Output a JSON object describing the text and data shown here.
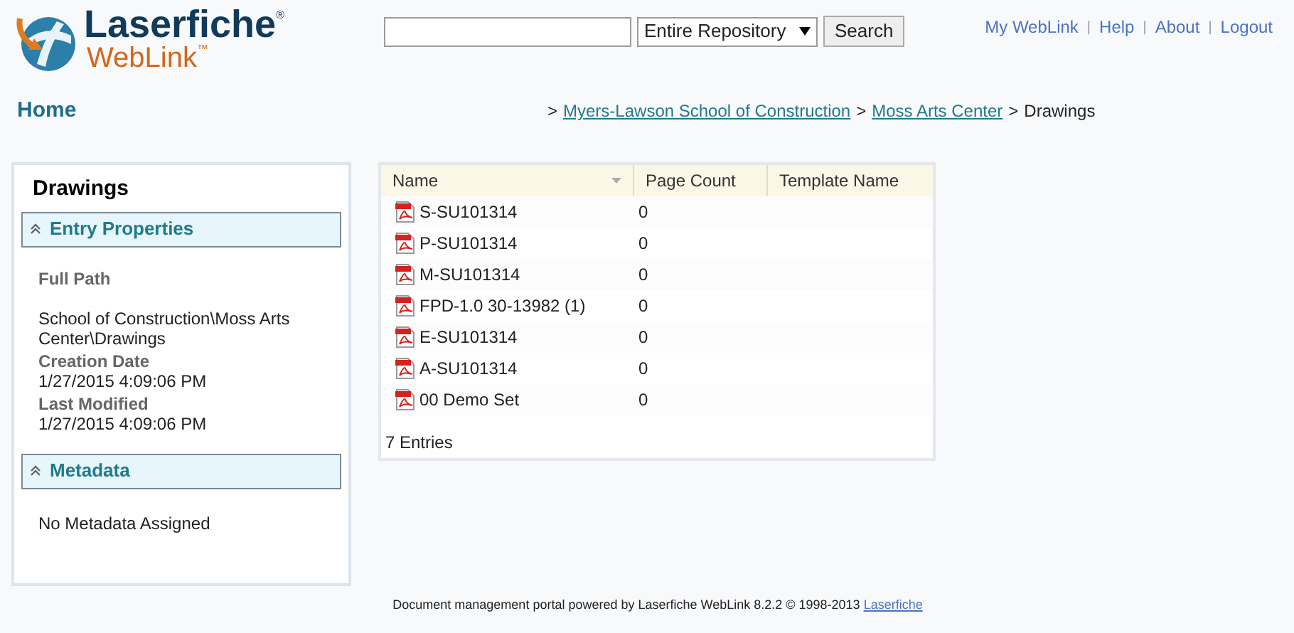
{
  "logo": {
    "brand": "Laserfiche",
    "brand_mark": "®",
    "product": "WebLink",
    "product_mark": "™"
  },
  "search": {
    "scope": "Entire Repository",
    "button": "Search"
  },
  "top_nav": {
    "separator": "|",
    "links": [
      "My WebLink",
      "Help",
      "About",
      "Logout"
    ]
  },
  "home": "Home",
  "breadcrumb": {
    "separator": ">",
    "items": [
      {
        "label": "Myers-Lawson School of Construction",
        "link": true
      },
      {
        "label": "Moss Arts Center",
        "link": true
      },
      {
        "label": "Drawings",
        "link": false
      }
    ]
  },
  "sidebar": {
    "title": "Drawings",
    "sections": [
      {
        "title": "Entry Properties",
        "expanded": true,
        "fields": [
          {
            "label": "Full Path",
            "value": "School of Construction\\Moss Arts Center\\Drawings"
          },
          {
            "label": "Creation Date",
            "value": "1/27/2015 4:09:06 PM"
          },
          {
            "label": "Last Modified",
            "value": "1/27/2015 4:09:06 PM"
          }
        ]
      },
      {
        "title": "Metadata",
        "expanded": true,
        "text": "No Metadata Assigned"
      }
    ]
  },
  "table": {
    "columns": [
      "Name",
      "Page Count",
      "Template Name"
    ],
    "rows": [
      {
        "name": "S-SU101314",
        "page_count": "0"
      },
      {
        "name": "P-SU101314",
        "page_count": "0"
      },
      {
        "name": "M-SU101314",
        "page_count": "0"
      },
      {
        "name": "FPD-1.0 30-13982 (1)",
        "page_count": "0"
      },
      {
        "name": "E-SU101314",
        "page_count": "0"
      },
      {
        "name": "A-SU101314",
        "page_count": "0"
      },
      {
        "name": "00 Demo Set",
        "page_count": "0"
      }
    ],
    "footer": "7 Entries"
  },
  "footer": {
    "text": "Document management portal powered by Laserfiche WebLink 8.2.2 © 1998-2013",
    "link": "Laserfiche"
  }
}
